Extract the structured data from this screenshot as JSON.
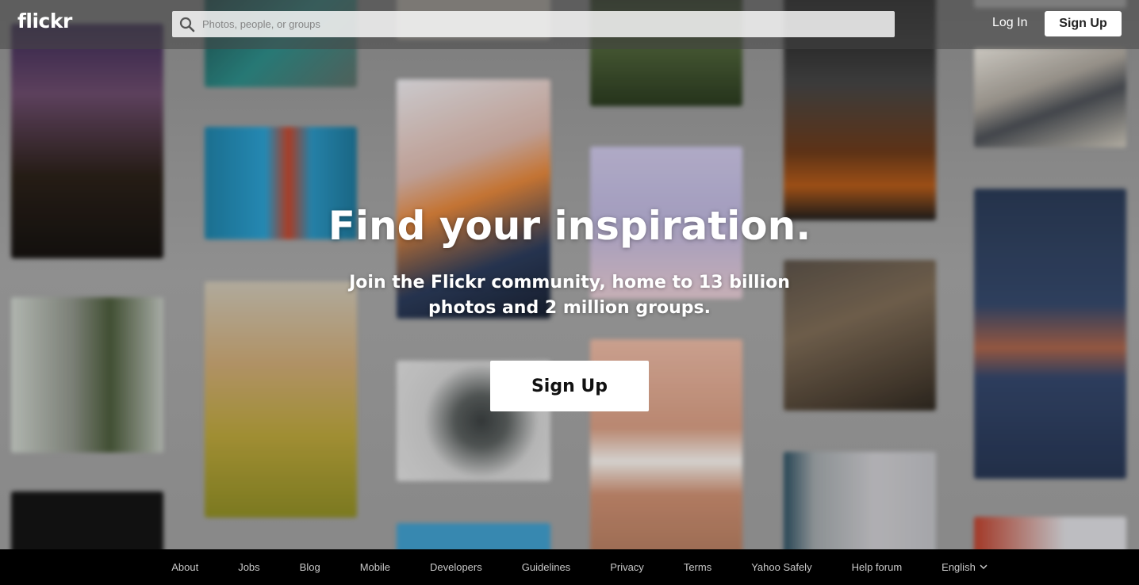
{
  "header": {
    "logo": "flickr",
    "search_placeholder": "Photos, people, or groups",
    "login_label": "Log In",
    "signup_label": "Sign Up"
  },
  "hero": {
    "title": "Find your inspiration.",
    "subtitle": "Join the Flickr community, home to 13 billion photos and 2 million groups.",
    "signup_label": "Sign Up"
  },
  "footer": {
    "links": [
      "About",
      "Jobs",
      "Blog",
      "Mobile",
      "Developers",
      "Guidelines",
      "Privacy",
      "Terms",
      "Yahoo Safely",
      "Help forum"
    ],
    "language": "English"
  },
  "icons": {
    "search": "search-icon",
    "language_dropdown": "chevron-down-icon"
  },
  "colors": {
    "header_overlay": "#464646",
    "footer_bg": "#000000",
    "button_bg": "#ffffff",
    "button_text": "#222222"
  }
}
